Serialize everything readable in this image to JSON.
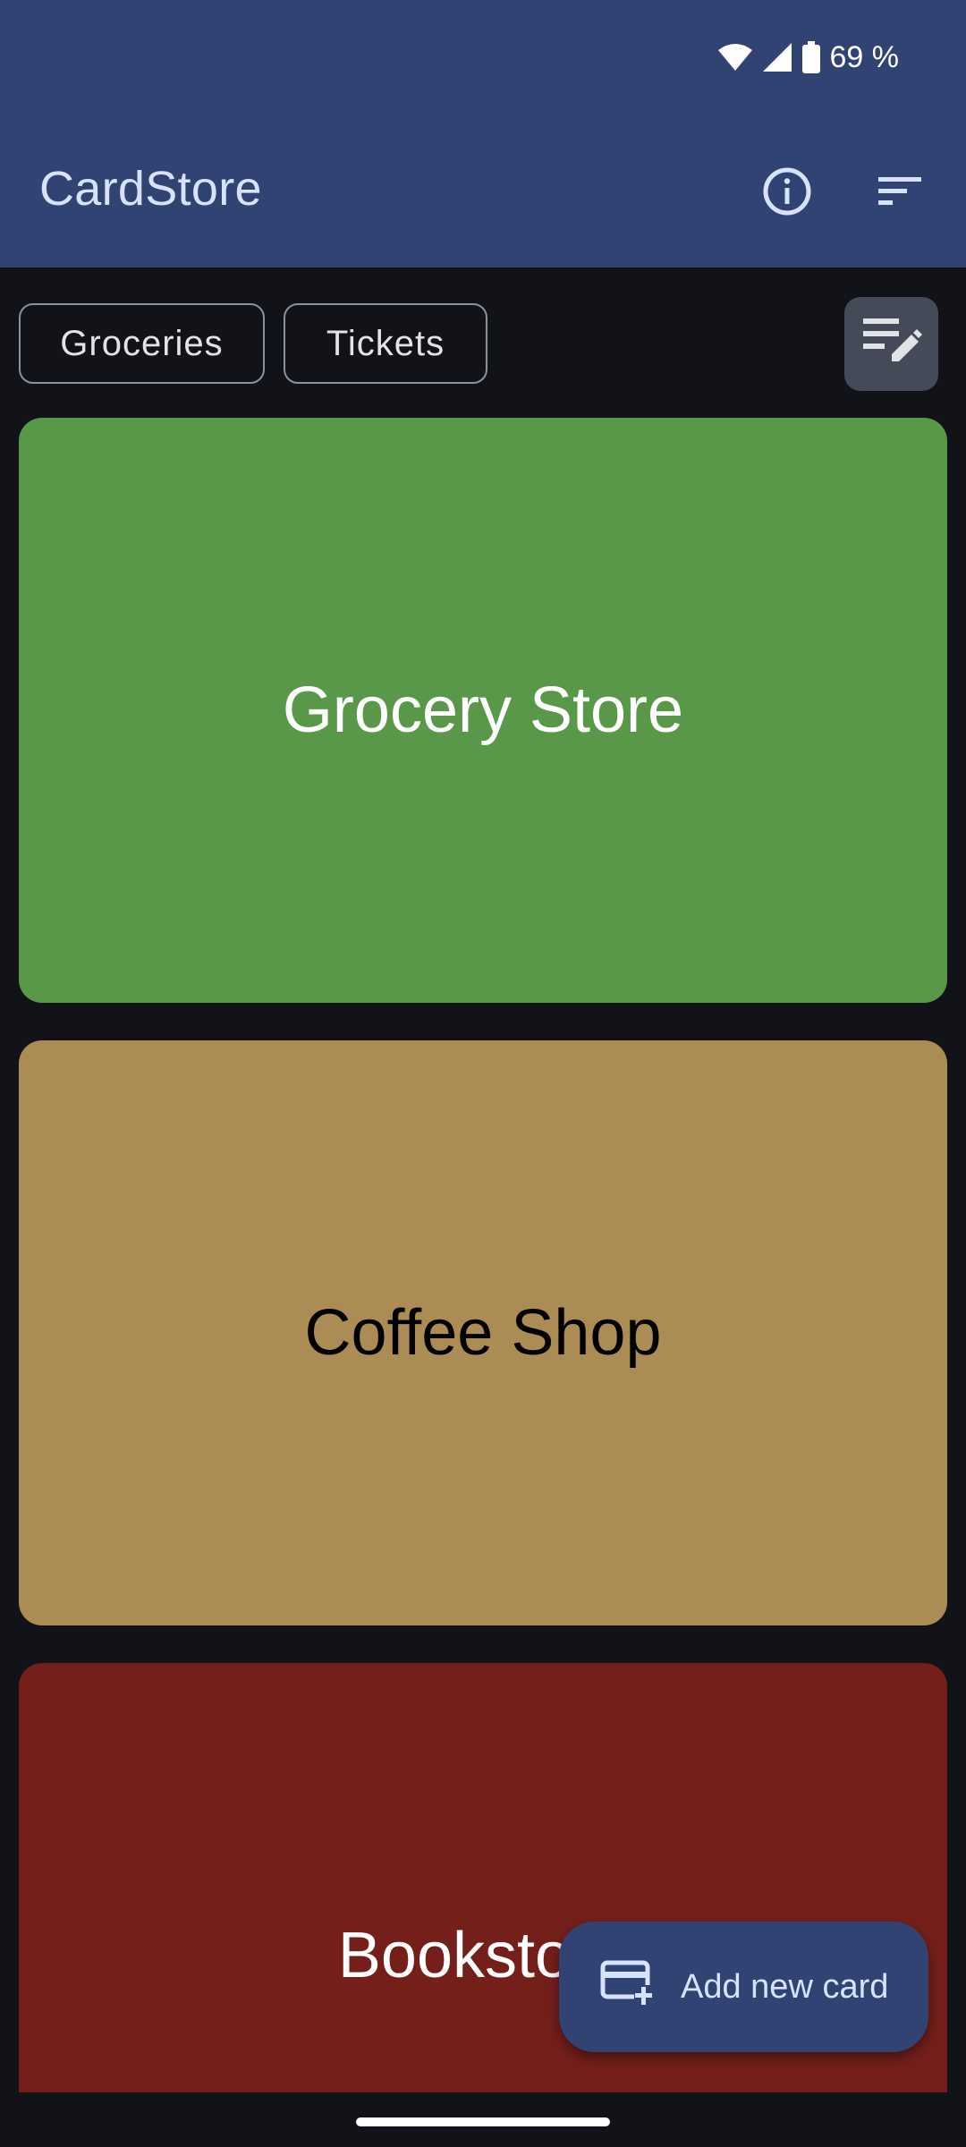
{
  "status_bar": {
    "battery_text": "69 %",
    "icons": [
      "wifi-icon",
      "cellular-signal-icon",
      "battery-icon"
    ]
  },
  "app_bar": {
    "title": "CardStore",
    "actions": [
      "info-icon",
      "sort-icon"
    ]
  },
  "filter_chips": [
    {
      "label": "Groceries"
    },
    {
      "label": "Tickets"
    }
  ],
  "edit_groups_icon": "edit-list-icon",
  "cards": [
    {
      "name": "Grocery Store",
      "color": "#5a9849",
      "text_color": "#ffffff"
    },
    {
      "name": "Coffee Shop",
      "color": "#ab8c55",
      "text_color": "#000000"
    },
    {
      "name": "Bookstore",
      "color": "#751f1b",
      "text_color": "#ffffff"
    }
  ],
  "fab": {
    "label": "Add new card",
    "icon": "add-card-icon"
  },
  "colors": {
    "app_bar": "#314372",
    "background": "#121318",
    "title_text": "#d7e2ff"
  }
}
